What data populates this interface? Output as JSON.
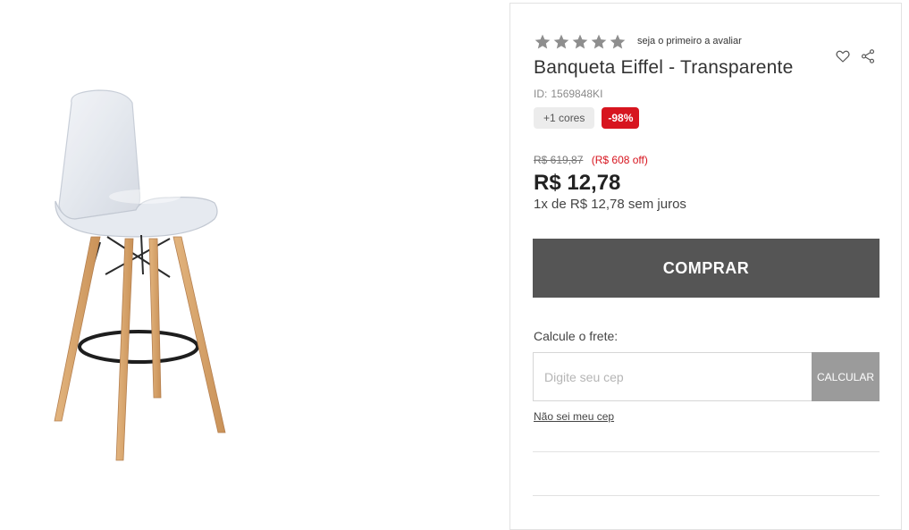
{
  "product": {
    "rating_text": "seja o primeiro a avaliar",
    "title": "Banqueta Eiffel - Transparente",
    "sku_prefix": "ID:",
    "sku": "1569848KI",
    "colors_badge": "+1 cores",
    "discount_badge": "-98%",
    "old_price": "R$ 619,87",
    "savings": "(R$ 608 off)",
    "price": "R$ 12,78",
    "installments": "1x de R$ 12,78 sem juros",
    "rating_stars": 0,
    "rating_max": 5
  },
  "buy": {
    "label": "COMPRAR"
  },
  "shipping": {
    "label": "Calcule o frete:",
    "placeholder": "Digite seu cep",
    "button": "CALCULAR",
    "link": "Não sei meu cep"
  },
  "colors": {
    "discount": "#d7151f",
    "buy_button": "#555555",
    "calc_button": "#9b9b9b",
    "star": "#8e8e8e"
  },
  "icons": [
    "star-icon",
    "heart-icon",
    "share-icon"
  ]
}
